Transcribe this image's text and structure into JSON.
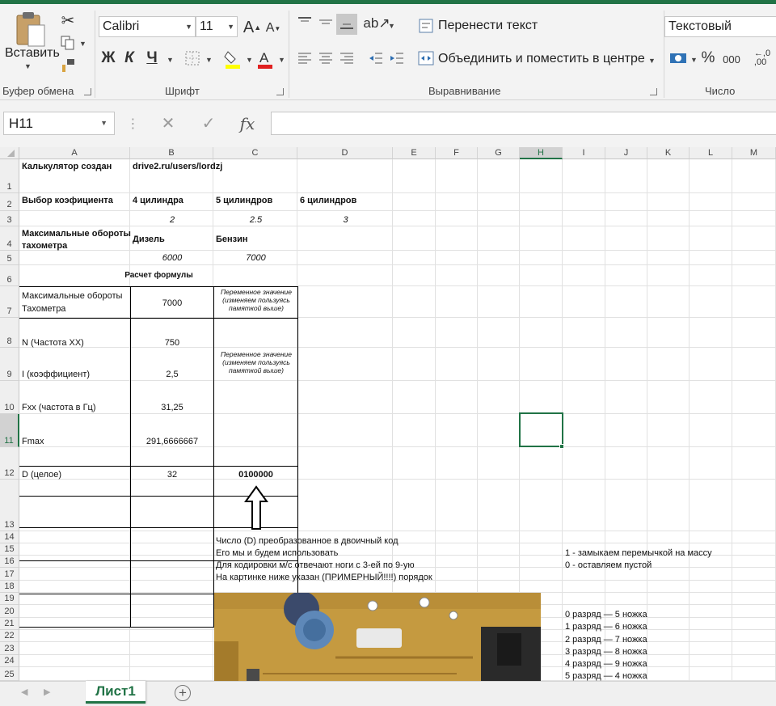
{
  "ribbon": {
    "clipboard": {
      "paste_label": "Вставить",
      "group_label": "Буфер обмена"
    },
    "font": {
      "name": "Calibri",
      "size": "11",
      "bold": "Ж",
      "italic": "К",
      "underline": "Ч",
      "group_label": "Шрифт"
    },
    "alignment": {
      "wrap_text": "Перенести текст",
      "merge_center": "Объединить и поместить в центре",
      "group_label": "Выравнивание"
    },
    "number": {
      "format": "Текстовый",
      "group_label": "Число",
      "percent": "%",
      "thousands": "000",
      "decimals": ",0​\n,00"
    }
  },
  "formula_bar": {
    "name_box": "H11",
    "fx": "fx",
    "content": ""
  },
  "columns": [
    "A",
    "B",
    "C",
    "D",
    "E",
    "F",
    "G",
    "H",
    "I",
    "J",
    "K",
    "L",
    "M"
  ],
  "rows": [
    "1",
    "2",
    "3",
    "4",
    "5",
    "6",
    "7",
    "8",
    "9",
    "10",
    "11",
    "12",
    "13",
    "14",
    "15",
    "16",
    "17",
    "18",
    "19",
    "20",
    "21",
    "22",
    "23",
    "24",
    "25"
  ],
  "cells": {
    "A1": "Калькулятор создан",
    "B1": "drive2.ru/users/lordzj",
    "A2": "Выбор коэфициента",
    "B2": "4 цилиндра",
    "C2": "5 цилиндров",
    "D2": "6 цилиндров",
    "B3": "2",
    "C3": "2.5",
    "D3": "3",
    "A4a": "Максимальные обороты",
    "A4b": "тахометра",
    "B4": "Дизель",
    "C4": "Бензин",
    "B5": "6000",
    "C5": "7000",
    "B6": "Расчет формулы",
    "A7a": "Максимальные обороты",
    "A7b": "Тахометра",
    "B7": "7000",
    "C7": "Переменное значение (изменяем пользуясь памяткой выше)",
    "A8": "N (Частота ХХ)",
    "B8": "750",
    "C9": "Переменное значение (изменяем пользуясь памяткой выше)",
    "A9": "I (коэффициент)",
    "B9": "2,5",
    "A10": "Fxx (частота в Гц)",
    "B10": "31,25",
    "A11": "Fmax",
    "B11": "291,6666667",
    "A12": "D (целое)",
    "B12": "32",
    "C12": "0100000",
    "C14": "Число (D) преобразованное в двоичный код",
    "C15": "Его мы и будем использовать",
    "C16": "Для кодировки м/с  отвечают ноги с 3-ей по 9-ую",
    "C17": "На картинке ниже указан (ПРИМЕРНЫЙ!!!!) порядок",
    "I15": "1 - замыкаем перемычкой на массу",
    "I16": "0 - оставляем пустой",
    "I20": "0 разряд — 5 ножка",
    "I21": "1 разряд — 6 ножка",
    "I22": "2 разряд — 7 ножка",
    "I23": "3 разряд — 8 ножка",
    "I24": "4 разряд — 9 ножка",
    "I25": "5 разряд — 4 ножка"
  },
  "sheet_tabs": [
    "Лист1"
  ],
  "colors": {
    "accent": "#217346",
    "pcb": "#c9a24a"
  }
}
